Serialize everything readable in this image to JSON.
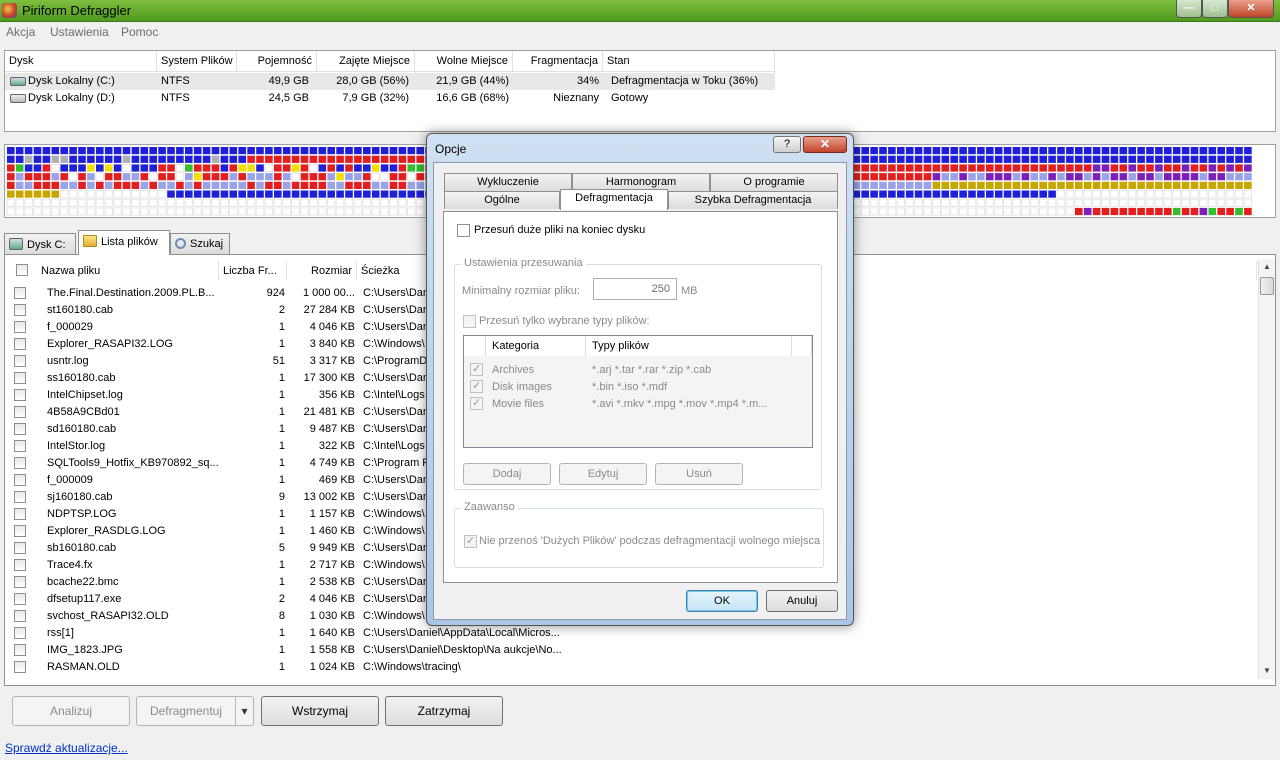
{
  "window": {
    "title": "Piriform Defraggler",
    "minimize": "—",
    "maximize": "□",
    "close": "✕"
  },
  "menu": [
    "Akcja",
    "Ustawienia",
    "Pomoc"
  ],
  "drives": {
    "columns": [
      "Dysk",
      "System Plików",
      "Pojemność",
      "Zajęte Miejsce",
      "Wolne Miejsce",
      "Fragmentacja",
      "Stan"
    ],
    "rows": [
      {
        "name": "Dysk Lokalny (C:)",
        "fs": "NTFS",
        "capacity": "49,9 GB",
        "used": "28,0 GB (56%)",
        "free": "21,9 GB (44%)",
        "frag": "34%",
        "state": "Defragmentacja w Toku (36%)",
        "selected": true
      },
      {
        "name": "Dysk Lokalny (D:)",
        "fs": "NTFS",
        "capacity": "24,5 GB",
        "used": "7,9 GB (32%)",
        "free": "16,6 GB (68%)",
        "frag": "Nieznany",
        "state": "Gotowy",
        "selected": false
      }
    ]
  },
  "map_colors": {
    "used": "#1f1fd8",
    "fragmented": "#e31e1e",
    "free": "#ffffff",
    "processing": "#9aa3e8",
    "mft": "#c8a600",
    "green": "#2fbf2f",
    "purple": "#7a20b8",
    "yellow": "#f4e000",
    "grey": "#b0b0b0"
  },
  "tabs": [
    {
      "label": "Dysk C:",
      "icon": "drive-icon",
      "active": false
    },
    {
      "label": "Lista plików",
      "icon": "folder-icon",
      "active": true
    },
    {
      "label": "Szukaj",
      "icon": "search-icon",
      "active": false
    }
  ],
  "files": {
    "columns": [
      "Nazwa pliku",
      "Liczba Fr...",
      "Rozmiar",
      "Ścieżka"
    ],
    "rows": [
      {
        "name": "The.Final.Destination.2009.PL.B...",
        "frags": "924",
        "size": "1 000 00...",
        "path": "C:\\Users\\Dan"
      },
      {
        "name": "st160180.cab",
        "frags": "2",
        "size": "27 284 KB",
        "path": "C:\\Users\\Dan"
      },
      {
        "name": "f_000029",
        "frags": "1",
        "size": "4 046 KB",
        "path": "C:\\Users\\Dan"
      },
      {
        "name": "Explorer_RASAPI32.LOG",
        "frags": "1",
        "size": "3 840 KB",
        "path": "C:\\Windows\\"
      },
      {
        "name": "usntr.log",
        "frags": "51",
        "size": "3 317 KB",
        "path": "C:\\ProgramDa"
      },
      {
        "name": "ss160180.cab",
        "frags": "1",
        "size": "17 300 KB",
        "path": "C:\\Users\\Dan"
      },
      {
        "name": "IntelChipset.log",
        "frags": "1",
        "size": "356 KB",
        "path": "C:\\Intel\\Logs"
      },
      {
        "name": "4B58A9CBd01",
        "frags": "1",
        "size": "21 481 KB",
        "path": "C:\\Users\\Dan"
      },
      {
        "name": "sd160180.cab",
        "frags": "1",
        "size": "9 487 KB",
        "path": "C:\\Users\\Dan"
      },
      {
        "name": "IntelStor.log",
        "frags": "1",
        "size": "322 KB",
        "path": "C:\\Intel\\Logs"
      },
      {
        "name": "SQLTools9_Hotfix_KB970892_sq...",
        "frags": "1",
        "size": "4 749 KB",
        "path": "C:\\Program Fi"
      },
      {
        "name": "f_000009",
        "frags": "1",
        "size": "469 KB",
        "path": "C:\\Users\\Dan"
      },
      {
        "name": "sj160180.cab",
        "frags": "9",
        "size": "13 002 KB",
        "path": "C:\\Users\\Dan"
      },
      {
        "name": "NDPTSP.LOG",
        "frags": "1",
        "size": "1 157 KB",
        "path": "C:\\Windows\\"
      },
      {
        "name": "Explorer_RASDLG.LOG",
        "frags": "1",
        "size": "1 460 KB",
        "path": "C:\\Windows\\"
      },
      {
        "name": "sb160180.cab",
        "frags": "5",
        "size": "9 949 KB",
        "path": "C:\\Users\\Dan"
      },
      {
        "name": "Trace4.fx",
        "frags": "1",
        "size": "2 717 KB",
        "path": "C:\\Windows\\"
      },
      {
        "name": "bcache22.bmc",
        "frags": "1",
        "size": "2 538 KB",
        "path": "C:\\Users\\Dan"
      },
      {
        "name": "dfsetup117.exe",
        "frags": "2",
        "size": "4 046 KB",
        "path": "C:\\Users\\Dan"
      },
      {
        "name": "svchost_RASAPI32.OLD",
        "frags": "8",
        "size": "1 030 KB",
        "path": "C:\\Windows\\"
      },
      {
        "name": "rss[1]",
        "frags": "1",
        "size": "1 640 KB",
        "path": "C:\\Users\\Daniel\\AppData\\Local\\Micros..."
      },
      {
        "name": "IMG_1823.JPG",
        "frags": "1",
        "size": "1 558 KB",
        "path": "C:\\Users\\Daniel\\Desktop\\Na aukcje\\No..."
      },
      {
        "name": "RASMAN.OLD",
        "frags": "1",
        "size": "1 024 KB",
        "path": "C:\\Windows\\tracing\\"
      }
    ]
  },
  "buttons": {
    "analyze": "Analizuj",
    "defrag": "Defragmentuj",
    "defrag_arrow": "▾",
    "pause": "Wstrzymaj",
    "stop": "Zatrzymaj"
  },
  "status_link": "Sprawdź aktualizacje...",
  "dialog": {
    "title": "Opcje",
    "help": "?",
    "close": "✕",
    "tabs_back": [
      "Wykluczenie",
      "Harmonogram",
      "O programie"
    ],
    "tabs_front": [
      "Ogólne",
      "Defragmentacja",
      "Szybka Defragmentacja"
    ],
    "move_large_label": "Przesuń duże pliki na koniec dysku",
    "move_settings_legend": "Ustawienia przesuwania",
    "min_size_label": "Minimalny rozmiar pliku:",
    "min_size_value": "250",
    "min_size_unit": "MB",
    "only_types_label": "Przesuń tylko wybrane typy plików:",
    "list_headers": [
      "Kategoria",
      "Typy plików"
    ],
    "list_rows": [
      {
        "category": "Archives",
        "types": "*.arj *.tar *.rar *.zip *.cab"
      },
      {
        "category": "Disk images",
        "types": "*.bin *.iso *.mdf"
      },
      {
        "category": "Movie files",
        "types": "*.avi *.mkv *.mpg *.mov *.mp4 *.m..."
      }
    ],
    "add": "Dodaj",
    "edit": "Edytuj",
    "remove": "Usuń",
    "advanced_legend": "Zaawanso",
    "no_move_label": "Nie przenoś 'Dużych Plików' podczas defragmentacji wolnego miejsca",
    "ok": "OK",
    "cancel": "Anuluj"
  }
}
